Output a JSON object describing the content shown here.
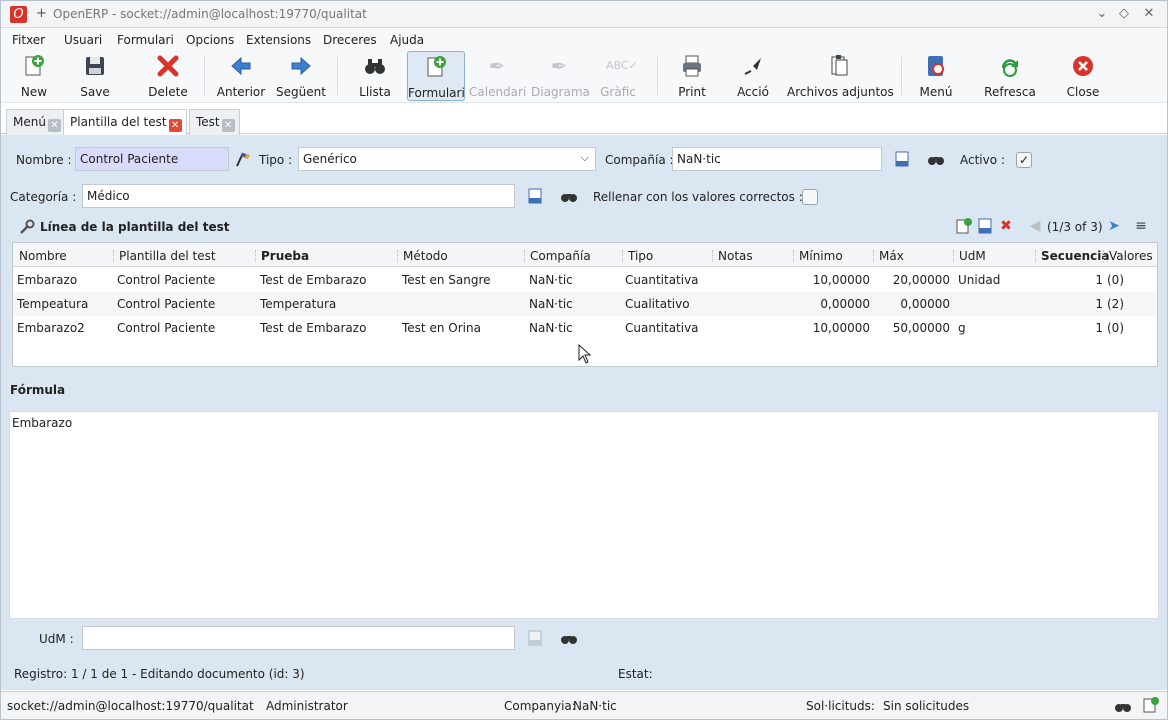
{
  "window": {
    "title": "OpenERP - socket://admin@localhost:19770/qualitat",
    "plus": "+",
    "logo": "O"
  },
  "menubar": [
    "Fitxer",
    "Usuari",
    "Formulari",
    "Opcions",
    "Extensions",
    "Dreceres",
    "Ajuda"
  ],
  "toolbar": {
    "new": "New",
    "save": "Save",
    "delete": "Delete",
    "previous": "Anterior",
    "next": "Següent",
    "list": "Llista",
    "form": "Formulari",
    "calendar": "Calendari",
    "diagram": "Diagrama",
    "graph": "Gràfic",
    "print": "Print",
    "action": "Acció",
    "attachments": "Archivos adjuntos",
    "menu": "Menú",
    "refresh": "Refresca",
    "close": "Close"
  },
  "tabs": [
    {
      "label": "Menú"
    },
    {
      "label": "Plantilla del test"
    },
    {
      "label": "Test"
    }
  ],
  "form": {
    "nombre_label": "Nombre :",
    "nombre_value": "Control Paciente",
    "tipo_label": "Tipo :",
    "tipo_value": "Genérico",
    "compania_label": "Compañía :",
    "compania_value": "NaN·tic",
    "activo_label": "Activo :",
    "categoria_label": "Categoría :",
    "categoria_value": "Médico",
    "rellenar_label": "Rellenar con los valores correctos :"
  },
  "lines": {
    "title": "Línea de la plantilla del test",
    "pager": "(1/3 of 3)",
    "columns": [
      "Nombre",
      "Plantilla del test",
      "Prueba",
      "Método",
      "Compañía",
      "Tipo",
      "Notas",
      "Mínimo",
      "Máx",
      "UdM",
      "Secuencia",
      "Valores"
    ],
    "rows": [
      [
        "Embarazo",
        "Control Paciente",
        "Test de Embarazo",
        "Test en Sangre",
        "NaN·tic",
        "Cuantitativa",
        "",
        "10,00000",
        "20,00000",
        "Unidad",
        "1",
        "(0)"
      ],
      [
        "Tempeatura",
        "Control Paciente",
        "Temperatura",
        "",
        "NaN·tic",
        "Cualitativo",
        "",
        "0,00000",
        "0,00000",
        "",
        "1",
        "(2)"
      ],
      [
        "Embarazo2",
        "Control Paciente",
        "Test de Embarazo",
        "Test en Orina",
        "NaN·tic",
        "Cuantitativa",
        "",
        "10,00000",
        "50,00000",
        "g",
        "1",
        "(0)"
      ]
    ]
  },
  "formula": {
    "label": "Fórmula",
    "value": "Embarazo"
  },
  "udm": {
    "label": "UdM :",
    "value": ""
  },
  "record": {
    "registro": "Registro: 1 / 1 de 1 - Editando documento (id: 3)",
    "estat": "Estat:"
  },
  "statusbar": {
    "connection": "socket://admin@localhost:19770/qualitat",
    "user": "Administrator",
    "company_label": "Companyia:",
    "company_value": "NaN·tic",
    "requests_label": "Sol·licituds:",
    "requests_value": "Sin solicitudes"
  },
  "colors": {
    "form_bg": "#dbe6f3",
    "required_field": "#d8dcfa",
    "delete_red": "#d9332b",
    "nav_blue": "#3f7fd0",
    "refresh_green": "#2e9b3c"
  }
}
